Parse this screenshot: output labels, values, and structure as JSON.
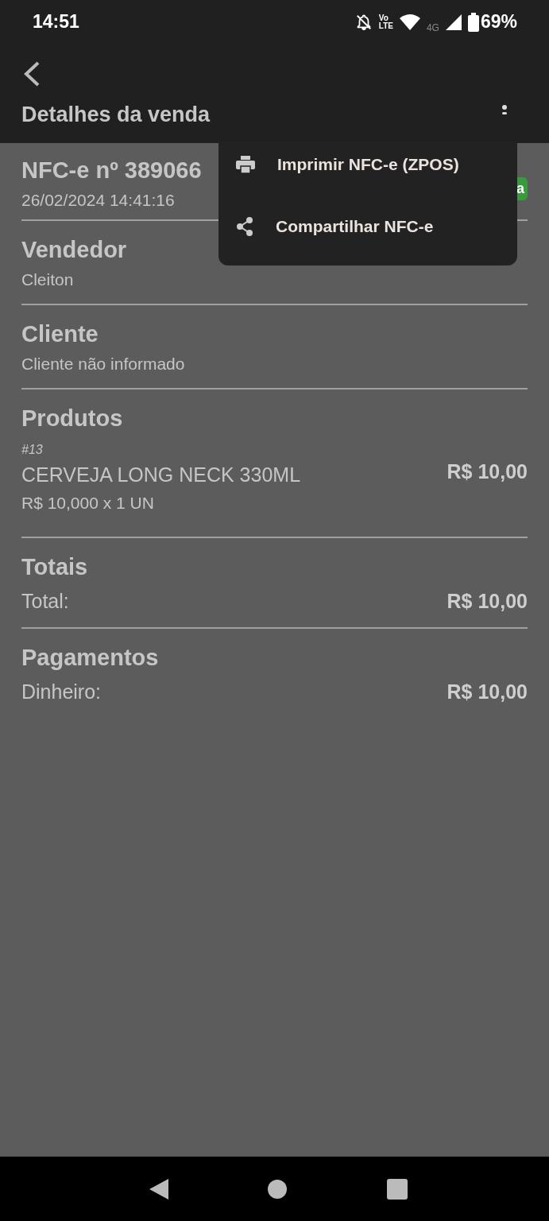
{
  "status_bar": {
    "time": "14:51",
    "volte_top": "Vo",
    "volte_bottom": "LTE",
    "network": "4G",
    "battery": "69%"
  },
  "app_bar": {
    "title": "Detalhes da venda"
  },
  "header": {
    "title": "NFC-e nº 389066",
    "date": "26/02/2024 14:41:16",
    "badge": {
      "text": "a",
      "color": "#3a9a3e"
    }
  },
  "sections": [
    {
      "kind": "text",
      "title": "Vendedor",
      "value": "Cleiton"
    },
    {
      "kind": "text",
      "title": "Cliente",
      "value": "Cliente não informado"
    },
    {
      "kind": "products",
      "title": "Produtos",
      "items": [
        {
          "code": "#13",
          "name": "CERVEJA LONG NECK 330ML",
          "detail": "R$ 10,000 x 1 UN",
          "price": "R$ 10,00"
        }
      ]
    },
    {
      "kind": "amounts",
      "title": "Totais",
      "rows": [
        {
          "label": "Total:",
          "value": "R$ 10,00"
        }
      ]
    },
    {
      "kind": "amounts",
      "title": "Pagamentos",
      "rows": [
        {
          "label": "Dinheiro:",
          "value": "R$ 10,00"
        }
      ]
    }
  ],
  "menu": [
    {
      "kind": "print",
      "label": "Imprimir NFC-e (ZPOS)"
    },
    {
      "kind": "share",
      "label": "Compartilhar NFC-e"
    }
  ]
}
